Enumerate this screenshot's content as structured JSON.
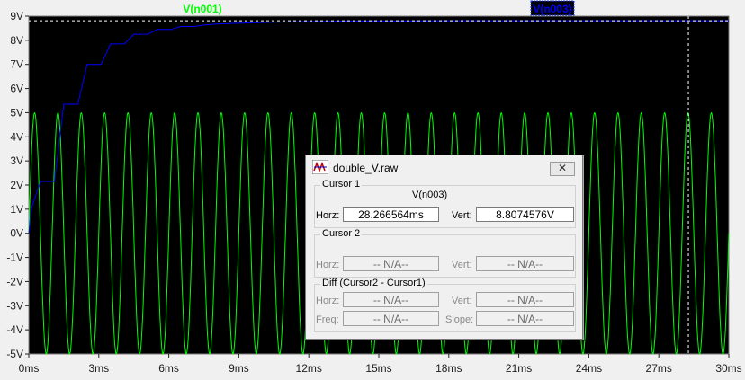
{
  "plot": {
    "trace_labels": [
      {
        "label": "V(n001)",
        "color": "#00ff00"
      },
      {
        "label": "V(n003)",
        "color": "#0000ff"
      }
    ],
    "x_ticks": [
      "0ms",
      "3ms",
      "6ms",
      "9ms",
      "12ms",
      "15ms",
      "18ms",
      "21ms",
      "24ms",
      "27ms",
      "30ms"
    ],
    "y_ticks": [
      "9V",
      "8V",
      "7V",
      "6V",
      "5V",
      "4V",
      "3V",
      "2V",
      "1V",
      "0V",
      "-1V",
      "-2V",
      "-3V",
      "-4V",
      "-5V"
    ],
    "x_range_ms": [
      0,
      30
    ],
    "y_range_v": [
      -5,
      9
    ],
    "green_series": {
      "amplitude_v": 5,
      "period_ms": 1,
      "start_ms": 0
    },
    "blue_series": {
      "steps_ms": [
        0,
        0.1,
        0.5,
        1.1,
        1.5,
        2.1,
        2.5,
        3.1,
        3.5,
        4.1,
        4.5,
        5.1,
        5.5,
        6.1,
        6.5,
        7.1,
        7.5,
        8.1,
        9.1,
        10.1,
        11.1,
        12.1,
        13.1,
        14.1,
        16.1,
        18.1,
        20.1,
        22.1,
        24.1,
        26.1,
        28.1,
        30
      ],
      "values_v": [
        0,
        1.0,
        2.15,
        2.15,
        5.35,
        5.35,
        7.0,
        7.0,
        7.85,
        7.85,
        8.25,
        8.25,
        8.45,
        8.45,
        8.57,
        8.57,
        8.63,
        8.68,
        8.71,
        8.74,
        8.76,
        8.78,
        8.79,
        8.8,
        8.8,
        8.81,
        8.81,
        8.81,
        8.81,
        8.81,
        8.81,
        8.81
      ]
    },
    "cursor_ms": 28.266564,
    "cursor_value_v": 8.8074576
  },
  "dialog": {
    "title": "double_V.raw",
    "close_label": "✕",
    "cursor1": {
      "group_label": "Cursor 1",
      "trace": "V(n003)",
      "horz_label": "Horz:",
      "horz_value": "28.266564ms",
      "vert_label": "Vert:",
      "vert_value": "8.8074576V"
    },
    "cursor2": {
      "group_label": "Cursor 2",
      "horz_label": "Horz:",
      "horz_value": "-- N/A--",
      "vert_label": "Vert:",
      "vert_value": "-- N/A--"
    },
    "diff": {
      "group_label": "Diff (Cursor2 - Cursor1)",
      "horz_label": "Horz:",
      "horz_value": "-- N/A--",
      "vert_label": "Vert:",
      "vert_value": "-- N/A--",
      "freq_label": "Freq:",
      "freq_value": "-- N/A--",
      "slope_label": "Slope:",
      "slope_value": "-- N/A--"
    }
  },
  "colors": {
    "background": "#000000",
    "grid": "#7f7f7f",
    "green_trace": "#00ff00",
    "blue_trace": "#0000ff",
    "cursor": "#ffffff"
  }
}
